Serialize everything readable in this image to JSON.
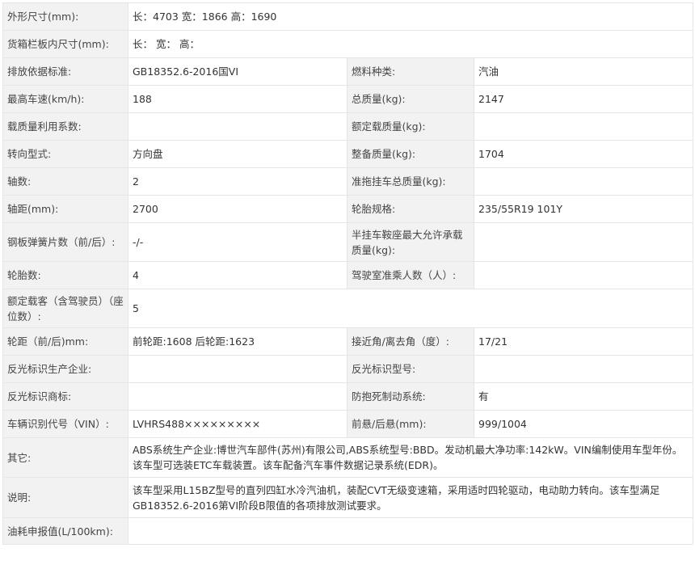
{
  "rows": [
    {
      "h": 34,
      "cells": [
        [
          "外形尺寸(mm):",
          "长：4703 宽：1866 高：1690"
        ]
      ]
    },
    {
      "h": 34,
      "cells": [
        [
          "货箱栏板内尺寸(mm):",
          "长： 宽： 高："
        ]
      ]
    },
    {
      "h": 34,
      "cells": [
        [
          "排放依据标准:",
          "GB18352.6-2016国VI"
        ],
        [
          "燃料种类:",
          "汽油"
        ]
      ]
    },
    {
      "h": 34,
      "cells": [
        [
          "最高车速(km/h):",
          "188"
        ],
        [
          "总质量(kg):",
          "2147"
        ]
      ]
    },
    {
      "h": 34,
      "cells": [
        [
          "载质量利用系数:",
          ""
        ],
        [
          "额定载质量(kg):",
          ""
        ]
      ]
    },
    {
      "h": 34,
      "cells": [
        [
          "转向型式:",
          "方向盘"
        ],
        [
          "整备质量(kg):",
          "1704"
        ]
      ]
    },
    {
      "h": 34,
      "cells": [
        [
          "轴数:",
          "2"
        ],
        [
          "准拖挂车总质量(kg):",
          ""
        ]
      ]
    },
    {
      "h": 34,
      "cells": [
        [
          "轴距(mm):",
          "2700"
        ],
        [
          "轮胎规格:",
          "235/55R19 101Y"
        ]
      ]
    },
    {
      "h": 48,
      "cells": [
        [
          "钢板弹簧片数（前/后）:",
          "-/-"
        ],
        [
          "半挂车鞍座最大允许承载质量(kg):",
          ""
        ]
      ]
    },
    {
      "h": 34,
      "cells": [
        [
          "轮胎数:",
          "4"
        ],
        [
          "驾驶室准乘人数（人）:",
          ""
        ]
      ]
    },
    {
      "h": 48,
      "cells": [
        [
          "额定载客（含驾驶员）（座位数）:",
          "5"
        ]
      ]
    },
    {
      "h": 34,
      "cells": [
        [
          "轮距（前/后)mm:",
          "前轮距:1608 后轮距:1623"
        ],
        [
          "接近角/离去角（度）:",
          "17/21"
        ]
      ]
    },
    {
      "h": 34,
      "cells": [
        [
          "反光标识生产企业:",
          ""
        ],
        [
          "反光标识型号:",
          ""
        ]
      ]
    },
    {
      "h": 34,
      "cells": [
        [
          "反光标识商标:",
          ""
        ],
        [
          "防抱死制动系统:",
          "有"
        ]
      ]
    },
    {
      "h": 34,
      "cells": [
        [
          "车辆识别代号（VIN）:",
          "LVHRS488×××××××××"
        ],
        [
          "前悬/后悬(mm):",
          "999/1004"
        ]
      ]
    },
    {
      "h": 49,
      "cells": [
        [
          "其它:",
          "ABS系统生产企业:博世汽车部件(苏州)有限公司,ABS系统型号:BBD。发动机最大净功率:142kW。VIN编制使用车型年份。该车型可选装ETC车载装置。该车配备汽车事件数据记录系统(EDR)。"
        ]
      ]
    },
    {
      "h": 50,
      "cells": [
        [
          "说明:",
          "该车型采用L15BZ型号的直列四缸水冷汽油机，装配CVT无级变速箱，采用适时四轮驱动，电动助力转向。该车型满足GB18352.6-2016第VI阶段B限值的各项排放测试要求。"
        ]
      ]
    },
    {
      "h": 33,
      "cells": [
        [
          "油耗申报值(L/100km):",
          ""
        ]
      ]
    }
  ]
}
